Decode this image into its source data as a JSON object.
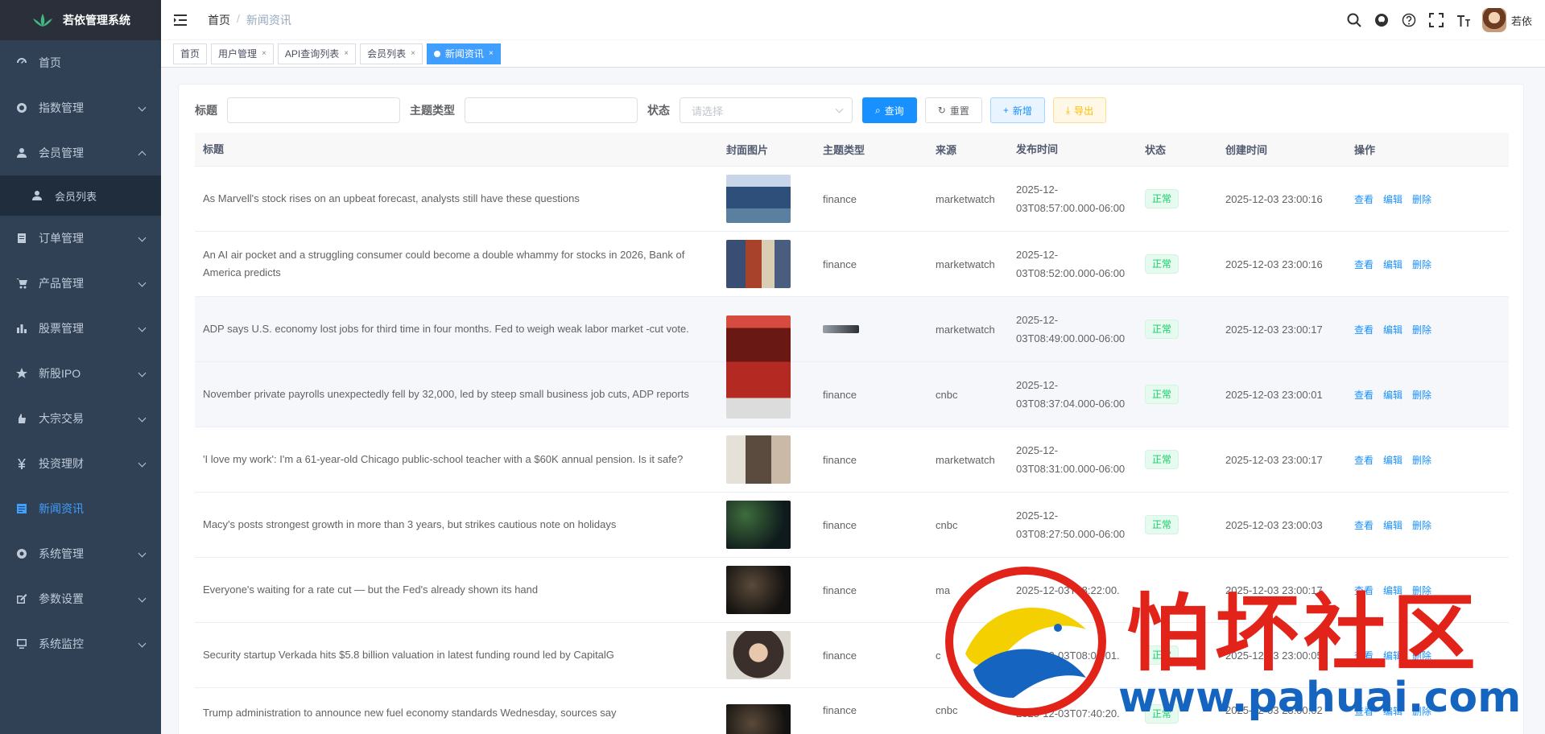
{
  "app": {
    "title": "若依管理系统"
  },
  "sidebar": {
    "items": [
      {
        "label": "首页",
        "icon": "dashboard-icon"
      },
      {
        "label": "指数管理",
        "icon": "chart-icon"
      },
      {
        "label": "会员管理",
        "icon": "user-icon"
      },
      {
        "label": "会员列表",
        "icon": "users-icon"
      },
      {
        "label": "订单管理",
        "icon": "order-icon"
      },
      {
        "label": "产品管理",
        "icon": "cart-icon"
      },
      {
        "label": "股票管理",
        "icon": "bar-chart-icon"
      },
      {
        "label": "新股IPO",
        "icon": "star-icon"
      },
      {
        "label": "大宗交易",
        "icon": "hand-icon"
      },
      {
        "label": "投资理财",
        "icon": "yen-icon"
      },
      {
        "label": "新闻资讯",
        "icon": "news-icon"
      },
      {
        "label": "系统管理",
        "icon": "gear-icon"
      },
      {
        "label": "参数设置",
        "icon": "edit-icon"
      },
      {
        "label": "系统监控",
        "icon": "monitor-icon"
      }
    ]
  },
  "navbar": {
    "breadcrumb_home": "首页",
    "breadcrumb_sep": "/",
    "breadcrumb_current": "新闻资讯",
    "username": "若依"
  },
  "tags": [
    {
      "label": "首页"
    },
    {
      "label": "用户管理",
      "close": "×"
    },
    {
      "label": "API查询列表",
      "close": "×"
    },
    {
      "label": "会员列表",
      "close": "×"
    },
    {
      "label": "新闻资讯",
      "close": "×"
    }
  ],
  "search": {
    "title_label": "标题",
    "type_label": "主题类型",
    "status_label": "状态",
    "status_placeholder": "请选择",
    "btn_query": "查询",
    "btn_reset": "重置",
    "btn_add": "新增",
    "btn_export": "导出"
  },
  "table": {
    "headers": {
      "title": "标题",
      "cover": "封面图片",
      "type": "主题类型",
      "source": "来源",
      "pub": "发布时间",
      "status": "状态",
      "created": "创建时间",
      "ops": "操作"
    },
    "ops": {
      "view": "查看",
      "edit": "编辑",
      "del": "删除"
    },
    "rows": [
      {
        "title": "As Marvell's stock rises on an upbeat forecast, analysts still have these questions",
        "type": "finance",
        "source": "marketwatch",
        "pub": "2025-12-03T08:57:00.000-06:00",
        "status": "正常",
        "created": "2025-12-03 23:00:16"
      },
      {
        "title": "An AI air pocket and a struggling consumer could become a double whammy for stocks in 2026, Bank of America predicts",
        "type": "finance",
        "source": "marketwatch",
        "pub": "2025-12-03T08:52:00.000-06:00",
        "status": "正常",
        "created": "2025-12-03 23:00:16"
      },
      {
        "title": "ADP says U.S. economy lost jobs for third time in four months. Fed to weigh weak labor market -cut vote.",
        "type": "",
        "source": "marketwatch",
        "pub": "2025-12-03T08:49:00.000-06:00",
        "status": "正常",
        "created": "2025-12-03 23:00:17"
      },
      {
        "title": "November private payrolls unexpectedly fell by 32,000, led by steep small business job cuts, ADP reports",
        "type": "finance",
        "source": "cnbc",
        "pub": "2025-12-03T08:37:04.000-06:00",
        "status": "正常",
        "created": "2025-12-03 23:00:01"
      },
      {
        "title": "'I love my work': I'm a 61-year-old Chicago public-school teacher with a $60K annual pension. Is it safe?",
        "type": "finance",
        "source": "marketwatch",
        "pub": "2025-12-03T08:31:00.000-06:00",
        "status": "正常",
        "created": "2025-12-03 23:00:17"
      },
      {
        "title": "Macy's posts strongest growth in more than 3 years, but strikes cautious note on holidays",
        "type": "finance",
        "source": "cnbc",
        "pub": "2025-12-03T08:27:50.000-06:00",
        "status": "正常",
        "created": "2025-12-03 23:00:03"
      },
      {
        "title": "Everyone's waiting for a rate cut — but the Fed's already shown its hand",
        "type": "finance",
        "source": "ma",
        "pub": "2025-12-03T08:22:00.",
        "status": "",
        "created": "2025-12-03 23:00:17"
      },
      {
        "title": "Security startup Verkada hits $5.8 billion valuation in latest funding round led by CapitalG",
        "type": "finance",
        "source": "c",
        "pub": "2025-12-03T08:00:01.",
        "status": "正常",
        "created": "2025-12-03 23:00:05"
      },
      {
        "title": "Trump administration to announce new fuel economy standards Wednesday, sources say",
        "type": "finance",
        "source": "cnbc",
        "pub": "2025-12-03T07:40:20.",
        "status": "正常",
        "created": "2025-12-03 23:00:02"
      }
    ]
  },
  "watermark": {
    "text": "怕坏社区",
    "url": "www.pahuai.com"
  }
}
